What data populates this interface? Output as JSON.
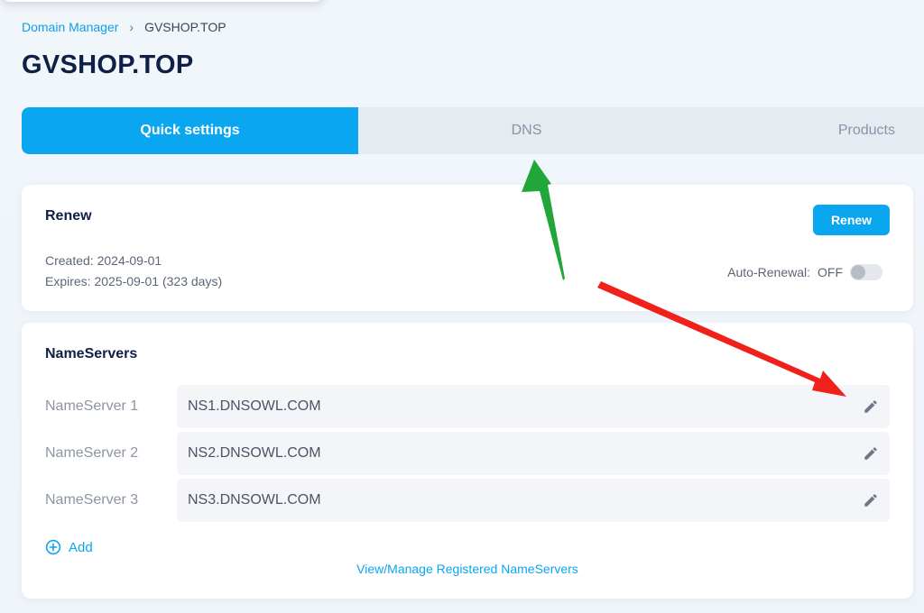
{
  "breadcrumb": {
    "parent": "Domain Manager",
    "separator": "›",
    "current": "GVSHOP.TOP"
  },
  "page_title": "GVSHOP.TOP",
  "tabs": [
    {
      "label": "Quick settings",
      "active": true
    },
    {
      "label": "DNS",
      "active": false
    },
    {
      "label": "Products",
      "active": false
    }
  ],
  "renew": {
    "title": "Renew",
    "button": "Renew",
    "created": "Created: 2024-09-01",
    "expires": "Expires: 2025-09-01 (323 days)",
    "auto_renewal_label": "Auto-Renewal:",
    "auto_renewal_state": "OFF"
  },
  "nameservers": {
    "title": "NameServers",
    "rows": [
      {
        "label": "NameServer 1",
        "value": "NS1.DNSOWL.COM"
      },
      {
        "label": "NameServer 2",
        "value": "NS2.DNSOWL.COM"
      },
      {
        "label": "NameServer 3",
        "value": "NS3.DNSOWL.COM"
      }
    ],
    "add_label": "Add",
    "manage_link": "View/Manage Registered NameServers"
  },
  "colors": {
    "accent": "#0aa6f0",
    "title": "#0f1f45",
    "annotation_green": "#22a63a",
    "annotation_red": "#f0201a"
  },
  "icons": [
    "chevron-right-icon",
    "edit-pencil-icon",
    "plus-circle-icon"
  ]
}
